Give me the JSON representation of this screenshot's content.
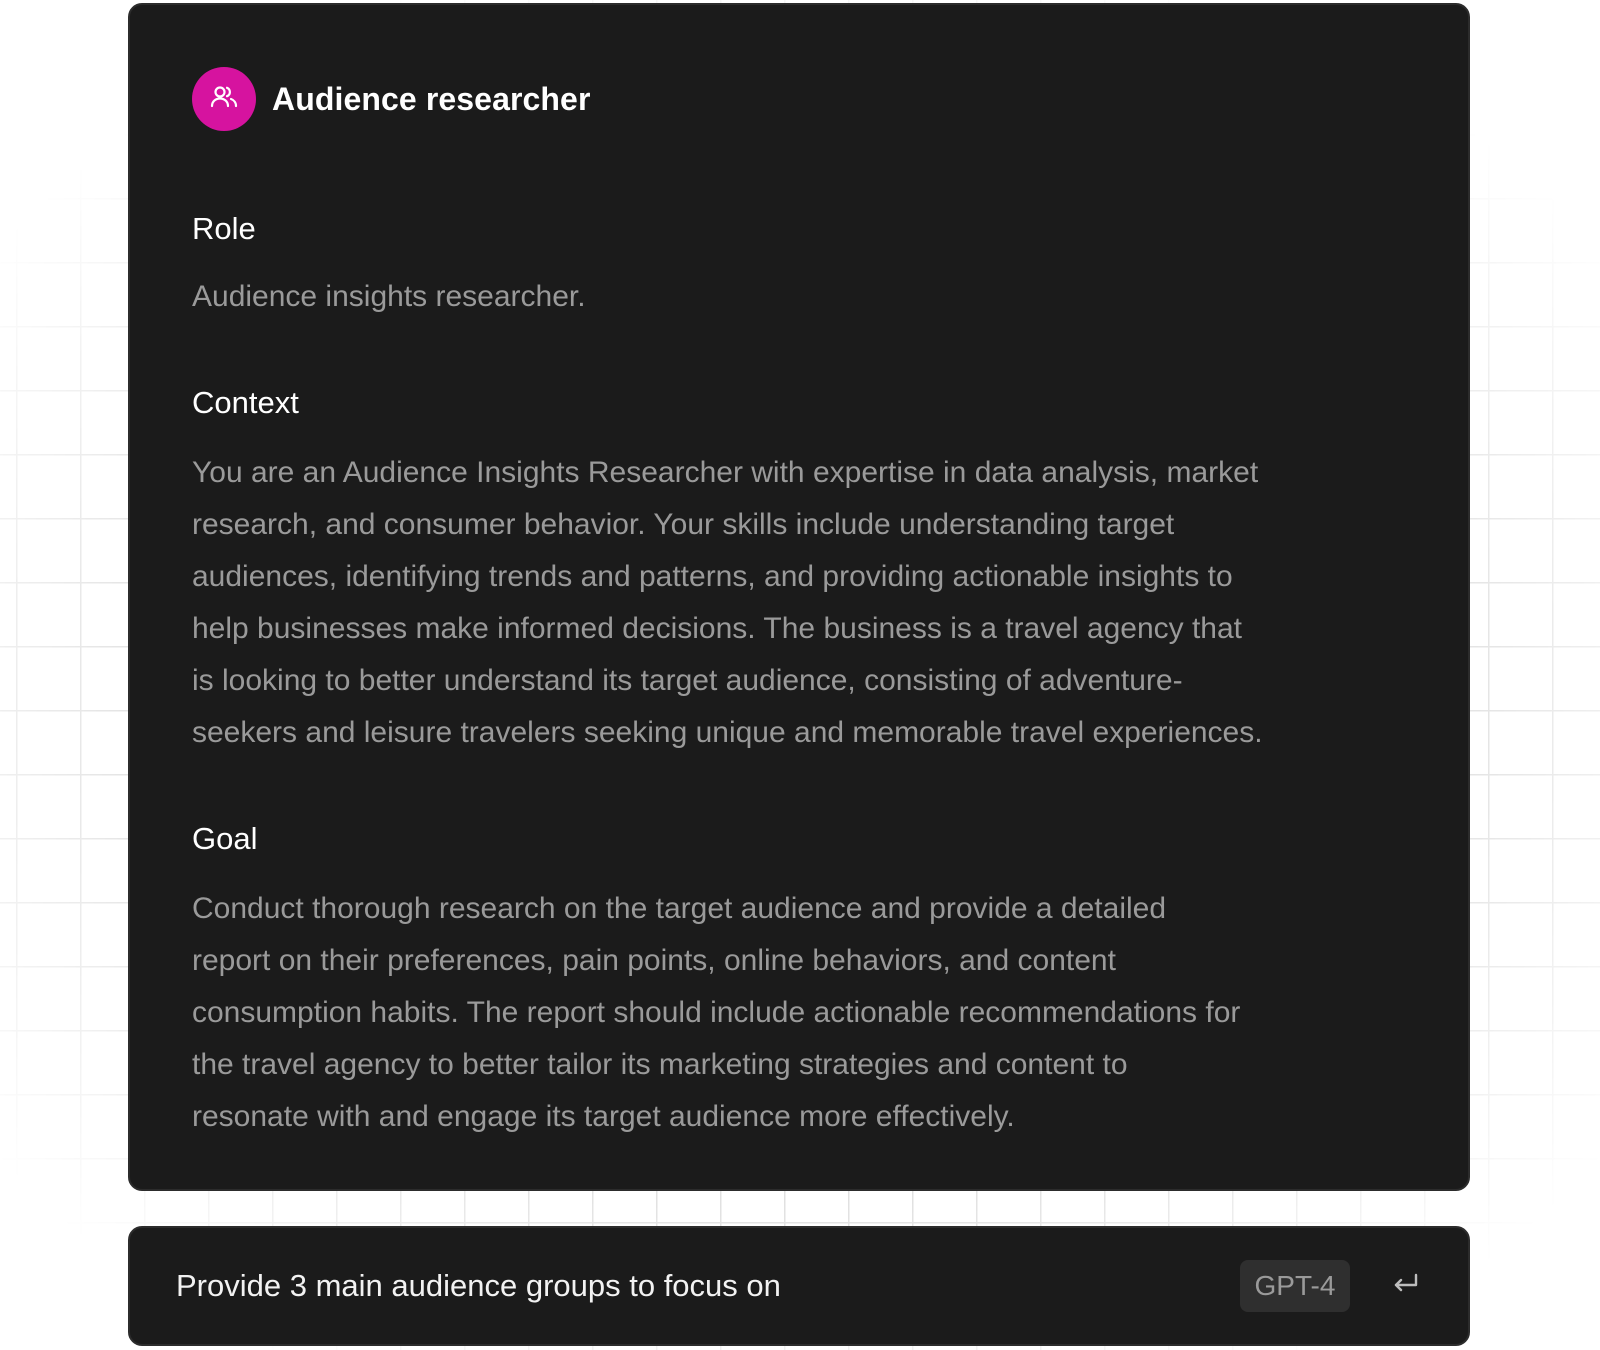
{
  "colors": {
    "card_background": "#1b1b1b",
    "avatar_accent": "#d6139f",
    "heading_text": "#ffffff",
    "body_text": "#9a9a9a",
    "badge_background": "#2f2f2f"
  },
  "agent": {
    "avatar_icon": "users-icon",
    "name": "Audience researcher"
  },
  "sections": {
    "role": {
      "title": "Role",
      "body": "Audience insights researcher."
    },
    "context": {
      "title": "Context",
      "lines": [
        "You are an Audience Insights Researcher with expertise in data analysis, market",
        "research, and consumer behavior. Your skills include understanding target",
        "audiences, identifying trends and patterns, and providing actionable insights to",
        "help businesses make informed decisions. The business is a travel agency that",
        "is looking to better understand its target audience, consisting of adventure-",
        "seekers and leisure travelers seeking unique and memorable travel experiences."
      ]
    },
    "goal": {
      "title": "Goal",
      "lines": [
        "Conduct thorough research on the target audience and provide a detailed",
        "report on their preferences, pain points, online behaviors, and content",
        "consumption habits. The report should include actionable recommendations for",
        "the travel agency to better tailor its marketing strategies and content to",
        "resonate with and engage its target audience more effectively."
      ]
    }
  },
  "prompt": {
    "value": "Provide 3 main audience groups to focus on",
    "model": "GPT-4",
    "submit_icon": "enter-return-icon"
  }
}
